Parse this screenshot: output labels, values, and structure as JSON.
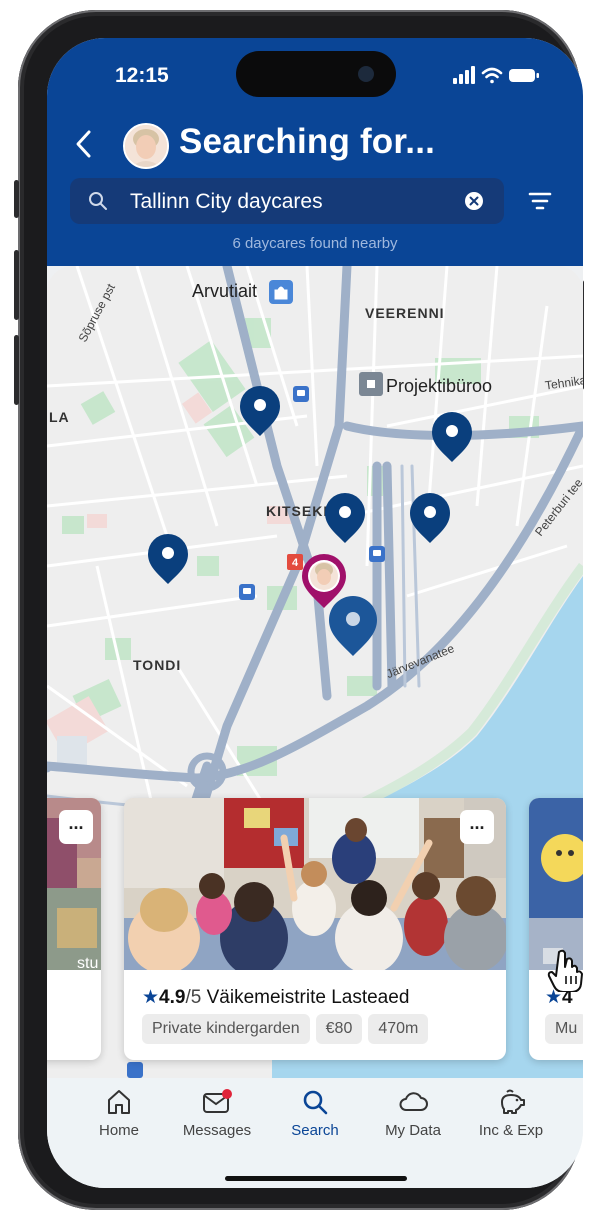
{
  "status": {
    "time": "12:15"
  },
  "header": {
    "title": "Searching for...",
    "search_value": "Tallinn City daycares",
    "result_count": "6 daycares found nearby"
  },
  "map": {
    "labels": {
      "arvutiait": "Arvutiait",
      "veerenni": "VEERENNI",
      "projektiburoo": "Projektibüroo",
      "kitseke": "KITSEKE",
      "tondi": "TONDI",
      "la": "LA",
      "sopruse": "Sõpruse pst",
      "tehnika": "Tehnika",
      "peterburi": "Peterburi tee",
      "jarvevana": "Järvevanatee",
      "road_number": "4"
    }
  },
  "cards": [
    {
      "more": "...",
      "partial_text": "stu"
    },
    {
      "more": "...",
      "rating": "4.9",
      "rating_out_of": "/5",
      "name": "Väikemeistrite Lasteaed",
      "chips": [
        "Private kindergarden",
        "€80",
        "470m"
      ]
    },
    {
      "rating_partial": "4",
      "chip_partial": "Mu"
    }
  ],
  "tabs": [
    {
      "label": "Home",
      "icon": "home-icon"
    },
    {
      "label": "Messages",
      "icon": "mail-icon"
    },
    {
      "label": "Search",
      "icon": "search-icon"
    },
    {
      "label": "My Data",
      "icon": "cloud-icon"
    },
    {
      "label": "Inc & Exp",
      "icon": "piggy-bank-icon"
    }
  ],
  "active_tab": "Search",
  "colors": {
    "header_blue": "#0a4596",
    "pin_blue": "#0a3f7d",
    "user_pin": "#a0106a",
    "water": "#a6d6ee",
    "notification_dot": "#e0243a"
  }
}
